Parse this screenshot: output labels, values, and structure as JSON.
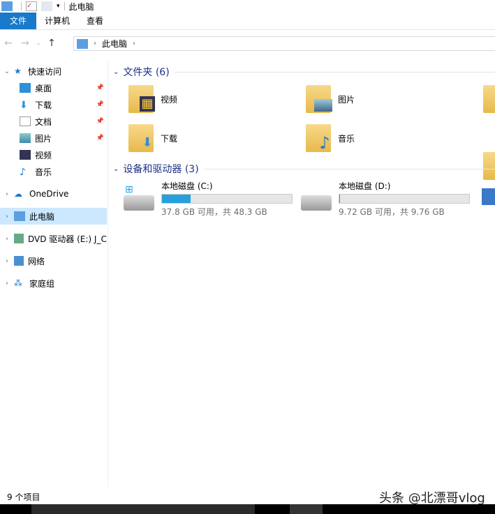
{
  "window": {
    "title": "此电脑"
  },
  "ribbon": {
    "tabs": [
      "文件",
      "计算机",
      "查看"
    ]
  },
  "nav": {
    "breadcrumb": "此电脑"
  },
  "sidebar": {
    "quick_access": "快速访问",
    "items": [
      "桌面",
      "下载",
      "文档",
      "图片",
      "视频",
      "音乐"
    ],
    "onedrive": "OneDrive",
    "this_pc": "此电脑",
    "dvd": "DVD 驱动器 (E:) J_C",
    "network": "网络",
    "homegroup": "家庭组"
  },
  "folders": {
    "header": "文件夹 (6)",
    "items": [
      "视频",
      "图片",
      "下载",
      "音乐"
    ]
  },
  "devices": {
    "header": "设备和驱动器 (3)",
    "drives": [
      {
        "name": "本地磁盘 (C:)",
        "info": "37.8 GB 可用，共 48.3 GB",
        "used_percent": 22
      },
      {
        "name": "本地磁盘 (D:)",
        "info": "9.72 GB 可用，共 9.76 GB",
        "used_percent": 0.4
      }
    ]
  },
  "status": {
    "count": "9 个项目"
  },
  "watermark": "头条 @北漂哥vlog"
}
